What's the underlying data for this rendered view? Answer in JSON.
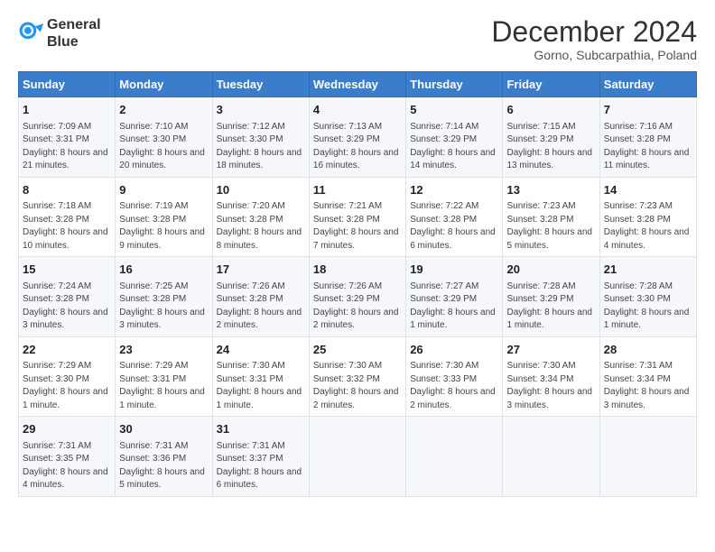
{
  "logo": {
    "line1": "General",
    "line2": "Blue"
  },
  "title": "December 2024",
  "subtitle": "Gorno, Subcarpathia, Poland",
  "header_days": [
    "Sunday",
    "Monday",
    "Tuesday",
    "Wednesday",
    "Thursday",
    "Friday",
    "Saturday"
  ],
  "weeks": [
    [
      {
        "day": "1",
        "sunrise": "Sunrise: 7:09 AM",
        "sunset": "Sunset: 3:31 PM",
        "daylight": "Daylight: 8 hours and 21 minutes."
      },
      {
        "day": "2",
        "sunrise": "Sunrise: 7:10 AM",
        "sunset": "Sunset: 3:30 PM",
        "daylight": "Daylight: 8 hours and 20 minutes."
      },
      {
        "day": "3",
        "sunrise": "Sunrise: 7:12 AM",
        "sunset": "Sunset: 3:30 PM",
        "daylight": "Daylight: 8 hours and 18 minutes."
      },
      {
        "day": "4",
        "sunrise": "Sunrise: 7:13 AM",
        "sunset": "Sunset: 3:29 PM",
        "daylight": "Daylight: 8 hours and 16 minutes."
      },
      {
        "day": "5",
        "sunrise": "Sunrise: 7:14 AM",
        "sunset": "Sunset: 3:29 PM",
        "daylight": "Daylight: 8 hours and 14 minutes."
      },
      {
        "day": "6",
        "sunrise": "Sunrise: 7:15 AM",
        "sunset": "Sunset: 3:29 PM",
        "daylight": "Daylight: 8 hours and 13 minutes."
      },
      {
        "day": "7",
        "sunrise": "Sunrise: 7:16 AM",
        "sunset": "Sunset: 3:28 PM",
        "daylight": "Daylight: 8 hours and 11 minutes."
      }
    ],
    [
      {
        "day": "8",
        "sunrise": "Sunrise: 7:18 AM",
        "sunset": "Sunset: 3:28 PM",
        "daylight": "Daylight: 8 hours and 10 minutes."
      },
      {
        "day": "9",
        "sunrise": "Sunrise: 7:19 AM",
        "sunset": "Sunset: 3:28 PM",
        "daylight": "Daylight: 8 hours and 9 minutes."
      },
      {
        "day": "10",
        "sunrise": "Sunrise: 7:20 AM",
        "sunset": "Sunset: 3:28 PM",
        "daylight": "Daylight: 8 hours and 8 minutes."
      },
      {
        "day": "11",
        "sunrise": "Sunrise: 7:21 AM",
        "sunset": "Sunset: 3:28 PM",
        "daylight": "Daylight: 8 hours and 7 minutes."
      },
      {
        "day": "12",
        "sunrise": "Sunrise: 7:22 AM",
        "sunset": "Sunset: 3:28 PM",
        "daylight": "Daylight: 8 hours and 6 minutes."
      },
      {
        "day": "13",
        "sunrise": "Sunrise: 7:23 AM",
        "sunset": "Sunset: 3:28 PM",
        "daylight": "Daylight: 8 hours and 5 minutes."
      },
      {
        "day": "14",
        "sunrise": "Sunrise: 7:23 AM",
        "sunset": "Sunset: 3:28 PM",
        "daylight": "Daylight: 8 hours and 4 minutes."
      }
    ],
    [
      {
        "day": "15",
        "sunrise": "Sunrise: 7:24 AM",
        "sunset": "Sunset: 3:28 PM",
        "daylight": "Daylight: 8 hours and 3 minutes."
      },
      {
        "day": "16",
        "sunrise": "Sunrise: 7:25 AM",
        "sunset": "Sunset: 3:28 PM",
        "daylight": "Daylight: 8 hours and 3 minutes."
      },
      {
        "day": "17",
        "sunrise": "Sunrise: 7:26 AM",
        "sunset": "Sunset: 3:28 PM",
        "daylight": "Daylight: 8 hours and 2 minutes."
      },
      {
        "day": "18",
        "sunrise": "Sunrise: 7:26 AM",
        "sunset": "Sunset: 3:29 PM",
        "daylight": "Daylight: 8 hours and 2 minutes."
      },
      {
        "day": "19",
        "sunrise": "Sunrise: 7:27 AM",
        "sunset": "Sunset: 3:29 PM",
        "daylight": "Daylight: 8 hours and 1 minute."
      },
      {
        "day": "20",
        "sunrise": "Sunrise: 7:28 AM",
        "sunset": "Sunset: 3:29 PM",
        "daylight": "Daylight: 8 hours and 1 minute."
      },
      {
        "day": "21",
        "sunrise": "Sunrise: 7:28 AM",
        "sunset": "Sunset: 3:30 PM",
        "daylight": "Daylight: 8 hours and 1 minute."
      }
    ],
    [
      {
        "day": "22",
        "sunrise": "Sunrise: 7:29 AM",
        "sunset": "Sunset: 3:30 PM",
        "daylight": "Daylight: 8 hours and 1 minute."
      },
      {
        "day": "23",
        "sunrise": "Sunrise: 7:29 AM",
        "sunset": "Sunset: 3:31 PM",
        "daylight": "Daylight: 8 hours and 1 minute."
      },
      {
        "day": "24",
        "sunrise": "Sunrise: 7:30 AM",
        "sunset": "Sunset: 3:31 PM",
        "daylight": "Daylight: 8 hours and 1 minute."
      },
      {
        "day": "25",
        "sunrise": "Sunrise: 7:30 AM",
        "sunset": "Sunset: 3:32 PM",
        "daylight": "Daylight: 8 hours and 2 minutes."
      },
      {
        "day": "26",
        "sunrise": "Sunrise: 7:30 AM",
        "sunset": "Sunset: 3:33 PM",
        "daylight": "Daylight: 8 hours and 2 minutes."
      },
      {
        "day": "27",
        "sunrise": "Sunrise: 7:30 AM",
        "sunset": "Sunset: 3:34 PM",
        "daylight": "Daylight: 8 hours and 3 minutes."
      },
      {
        "day": "28",
        "sunrise": "Sunrise: 7:31 AM",
        "sunset": "Sunset: 3:34 PM",
        "daylight": "Daylight: 8 hours and 3 minutes."
      }
    ],
    [
      {
        "day": "29",
        "sunrise": "Sunrise: 7:31 AM",
        "sunset": "Sunset: 3:35 PM",
        "daylight": "Daylight: 8 hours and 4 minutes."
      },
      {
        "day": "30",
        "sunrise": "Sunrise: 7:31 AM",
        "sunset": "Sunset: 3:36 PM",
        "daylight": "Daylight: 8 hours and 5 minutes."
      },
      {
        "day": "31",
        "sunrise": "Sunrise: 7:31 AM",
        "sunset": "Sunset: 3:37 PM",
        "daylight": "Daylight: 8 hours and 6 minutes."
      },
      null,
      null,
      null,
      null
    ]
  ]
}
